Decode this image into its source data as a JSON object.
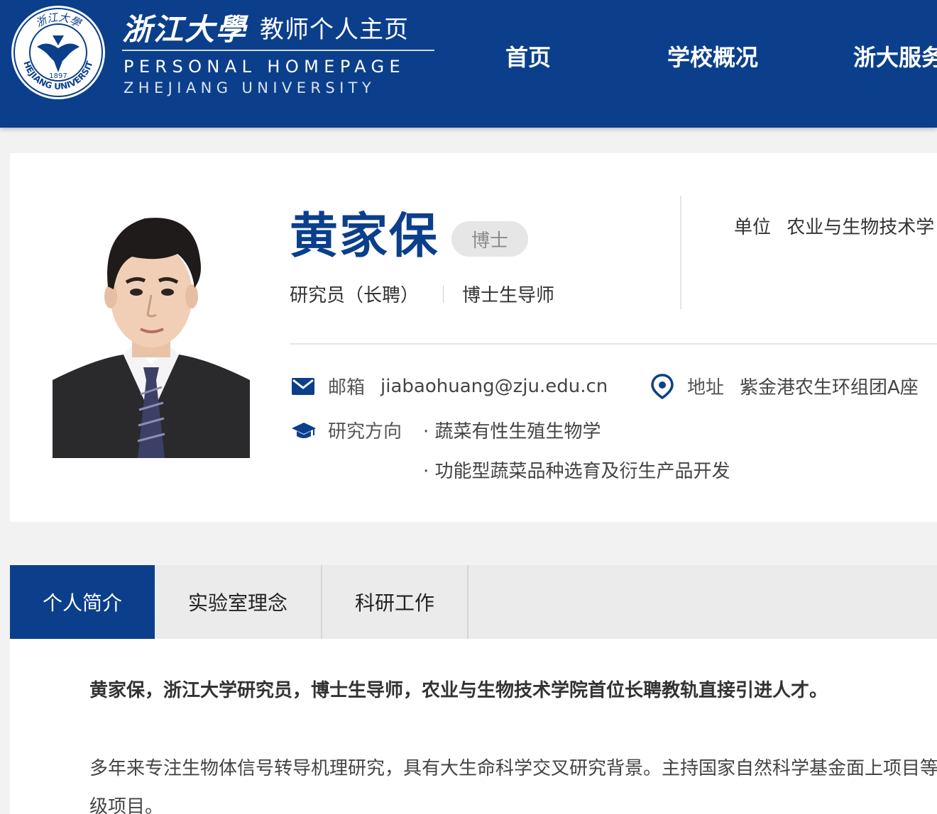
{
  "header": {
    "seal_year": "1897",
    "seal_text": "ZHEJIANG UNIVERSITY",
    "seal_calligraphy": "浙江大學",
    "brand_calligraphy": "浙江大學",
    "brand_subtitle": "教师个人主页",
    "brand_en_line1": "PERSONAL HOMEPAGE",
    "brand_en_line2": "ZHEJIANG UNIVERSITY",
    "nav": [
      "首页",
      "学校概况",
      "浙大服务"
    ]
  },
  "profile": {
    "name": "黄家保",
    "degree_badge": "博士",
    "title": "研究员（长聘）",
    "supervisor": "博士生导师",
    "unit_label": "单位",
    "unit_value": "农业与生物技术学",
    "email_label": "邮箱",
    "email_value": "jiabaohuang@zju.edu.cn",
    "address_label": "地址",
    "address_value": "紫金港农生环组团A座",
    "research_label": "研究方向",
    "research_topics": [
      "· 蔬菜有性生殖生物学",
      "· 功能型蔬菜品种选育及衍生产品开发"
    ]
  },
  "tabs": [
    {
      "label": "个人简介",
      "active": true
    },
    {
      "label": "实验室理念",
      "active": false
    },
    {
      "label": "科研工作",
      "active": false
    }
  ],
  "content": {
    "intro_bold": "黄家保，浙江大学研究员，博士生导师，农业与生物技术学院首位长聘教轨直接引进人才。",
    "intro_text": "多年来专注生物体信号转导机理研究，具有大生命科学交叉研究背景。主持国家自然科学基金面上项目等国家和省级项目。"
  },
  "colors": {
    "brand_blue": "#0b3f8c",
    "tab_bg": "#ebebeb",
    "badge_bg": "#e6e6e6"
  },
  "icons": [
    "seal-logo",
    "mail-icon",
    "location-pin-icon",
    "graduation-cap-icon"
  ]
}
